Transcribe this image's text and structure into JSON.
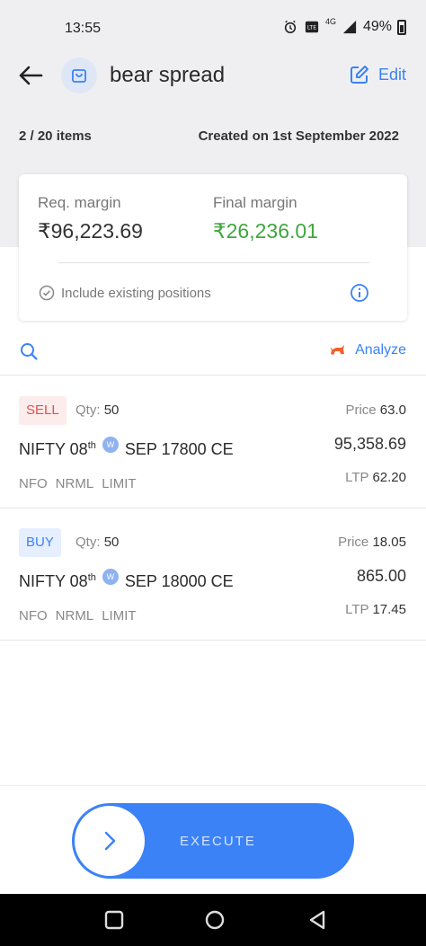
{
  "status_bar": {
    "time": "13:55",
    "network": "4G",
    "battery": "49%",
    "icons": [
      "alarm-icon",
      "volte-icon",
      "signal-icon",
      "battery-icon"
    ]
  },
  "header": {
    "title": "bear spread",
    "edit_label": "Edit",
    "icons": [
      "back-arrow-icon",
      "basket-icon",
      "edit-icon"
    ]
  },
  "summary": {
    "items_count": "2 / 20 items",
    "created_on": "Created on 1st September 2022"
  },
  "margin": {
    "required_label": "Req. margin",
    "required_value": "₹96,223.69",
    "final_label": "Final margin",
    "final_value": "₹26,236.01",
    "include_positions_label": "Include existing positions"
  },
  "toolbar": {
    "analyze_label": "Analyze",
    "icons": [
      "search-icon",
      "bull-icon"
    ]
  },
  "orders": [
    {
      "side": "SELL",
      "qty_label": "Qty:",
      "qty": "50",
      "symbol": "NIFTY 08",
      "date_suffix": "th",
      "weekly_badge": "W",
      "contract": "SEP 17800 CE",
      "exchange": "NFO",
      "product": "NRML",
      "order_type": "LIMIT",
      "price_label": "Price",
      "price": "63.0",
      "value": "95,358.69",
      "ltp_label": "LTP",
      "ltp": "62.20"
    },
    {
      "side": "BUY",
      "qty_label": "Qty:",
      "qty": "50",
      "symbol": "NIFTY 08",
      "date_suffix": "th",
      "weekly_badge": "W",
      "contract": "SEP 18000 CE",
      "exchange": "NFO",
      "product": "NRML",
      "order_type": "LIMIT",
      "price_label": "Price",
      "price": "18.05",
      "value": "865.00",
      "ltp_label": "LTP",
      "ltp": "17.45"
    }
  ],
  "execute": {
    "label": "EXECUTE"
  },
  "colors": {
    "accent": "#3b82f6",
    "profit_green": "#3fa63f",
    "sell_red": "#e05252",
    "header_bg": "#efeff1"
  }
}
